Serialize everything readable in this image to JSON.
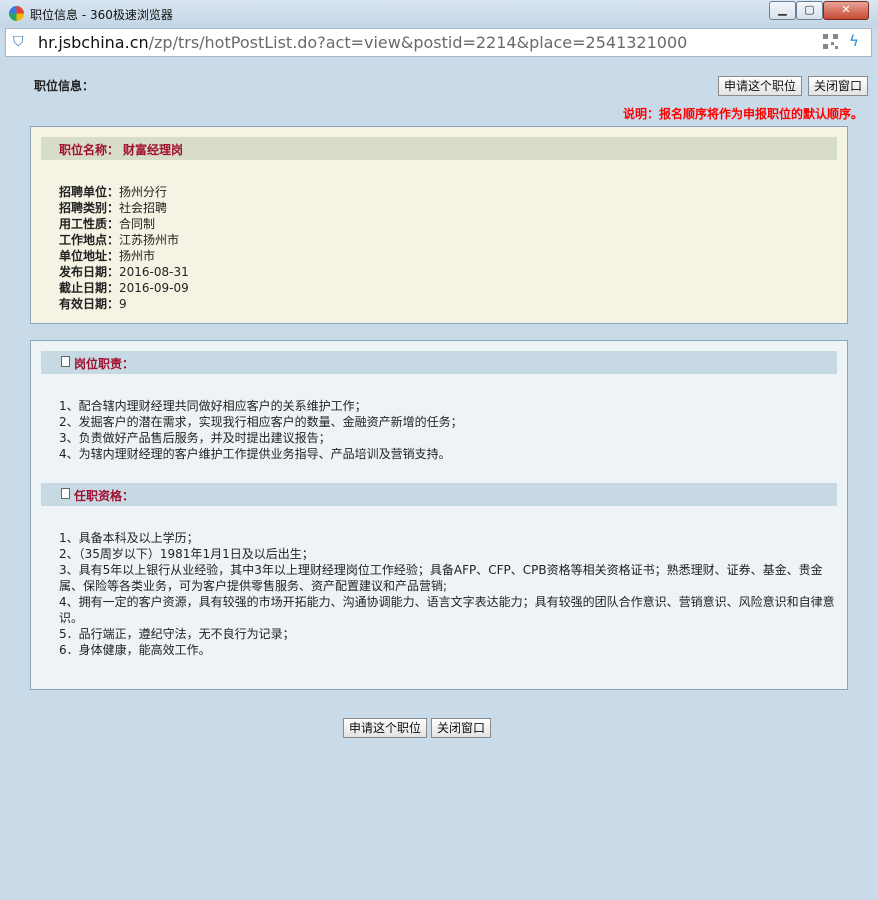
{
  "window": {
    "title": "职位信息 - 360极速浏览器",
    "min_label": "▁",
    "max_label": "▢",
    "close_label": "✕"
  },
  "address": {
    "host": "hr.jsbchina.cn",
    "path": "/zp/trs/hotPostList.do?act=view&postid=2214&place=2541321000"
  },
  "icons": {
    "shield": "shield-icon",
    "qr": "qr-code-icon",
    "bolt": "lightning-icon"
  },
  "page": {
    "label": "职位信息：",
    "apply_label": "申请这个职位",
    "close_label": "关闭窗口",
    "notice": "说明：报名顺序将作为申报职位的默认顺序。"
  },
  "job": {
    "name_label": "职位名称：",
    "name_value": "财富经理岗",
    "fields": [
      {
        "k": "招聘单位：",
        "v": "扬州分行"
      },
      {
        "k": "招聘类别：",
        "v": "社会招聘"
      },
      {
        "k": "用工性质：",
        "v": "合同制"
      },
      {
        "k": "工作地点：",
        "v": "江苏扬州市"
      },
      {
        "k": "单位地址：",
        "v": "扬州市"
      },
      {
        "k": "发布日期：",
        "v": "2016-08-31"
      },
      {
        "k": "截止日期：",
        "v": "2016-09-09"
      },
      {
        "k": "有效日期：",
        "v": "9"
      }
    ]
  },
  "duties": {
    "title": "岗位职责：",
    "lines": [
      "1、配合辖内理财经理共同做好相应客户的关系维护工作；",
      "2、发掘客户的潜在需求，实现我行相应客户的数量、金融资产新增的任务；",
      "3、负责做好产品售后服务，并及时提出建议报告；",
      "4、为辖内理财经理的客户维护工作提供业务指导、产品培训及营销支持。"
    ]
  },
  "qualifications": {
    "title": "任职资格：",
    "lines": [
      "1、具备本科及以上学历；",
      "2、（35周岁以下）1981年1月1日及以后出生；",
      "3、具有5年以上银行从业经验，其中3年以上理财经理岗位工作经验；具备AFP、CFP、CPB资格等相关资格证书；熟悉理财、证券、基金、贵金属、保险等各类业务，可为客户提供零售服务、资产配置建议和产品营销;",
      "4、拥有一定的客户资源，具有较强的市场开拓能力、沟通协调能力、语言文字表达能力；具有较强的团队合作意识、营销意识、风险意识和自律意识。",
      "5．品行端正，遵纪守法，无不良行为记录；",
      "6．身体健康，能高效工作。"
    ]
  }
}
